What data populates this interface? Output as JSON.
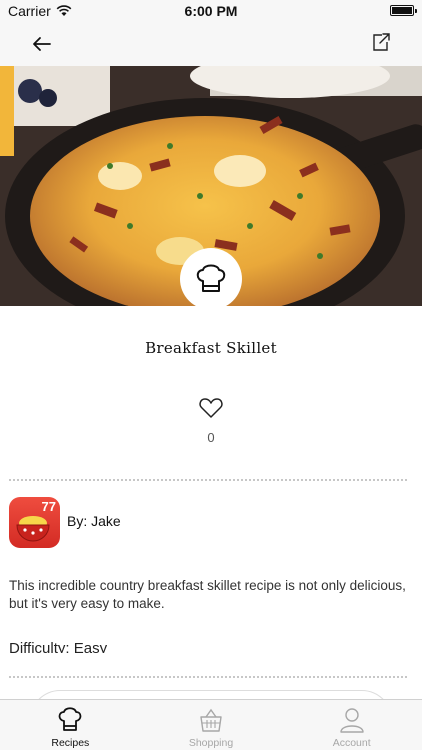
{
  "status_bar": {
    "carrier": "Carrier",
    "time": "6:00 PM"
  },
  "nav": {
    "back_icon": "arrow-left-icon",
    "share_icon": "share-icon"
  },
  "recipe": {
    "title": "Breakfast Skillet",
    "likes": "0",
    "author": "By: Jake",
    "author_badge": "77",
    "description": "This incredible country breakfast skillet recipe is not only delicious, but it's very easy to make.",
    "difficulty": "Difficulty: Easy"
  },
  "tabs": [
    {
      "label": "Recipes",
      "icon": "chef-hat-icon",
      "active": true
    },
    {
      "label": "Shopping",
      "icon": "basket-icon",
      "active": false
    },
    {
      "label": "Account",
      "icon": "user-icon",
      "active": false
    }
  ],
  "colors": {
    "bar_background": "#f7f7f7",
    "avatar_red": "#e53b32",
    "divider": "#c7c7c7",
    "inactive_tab": "#a7a7a7"
  }
}
